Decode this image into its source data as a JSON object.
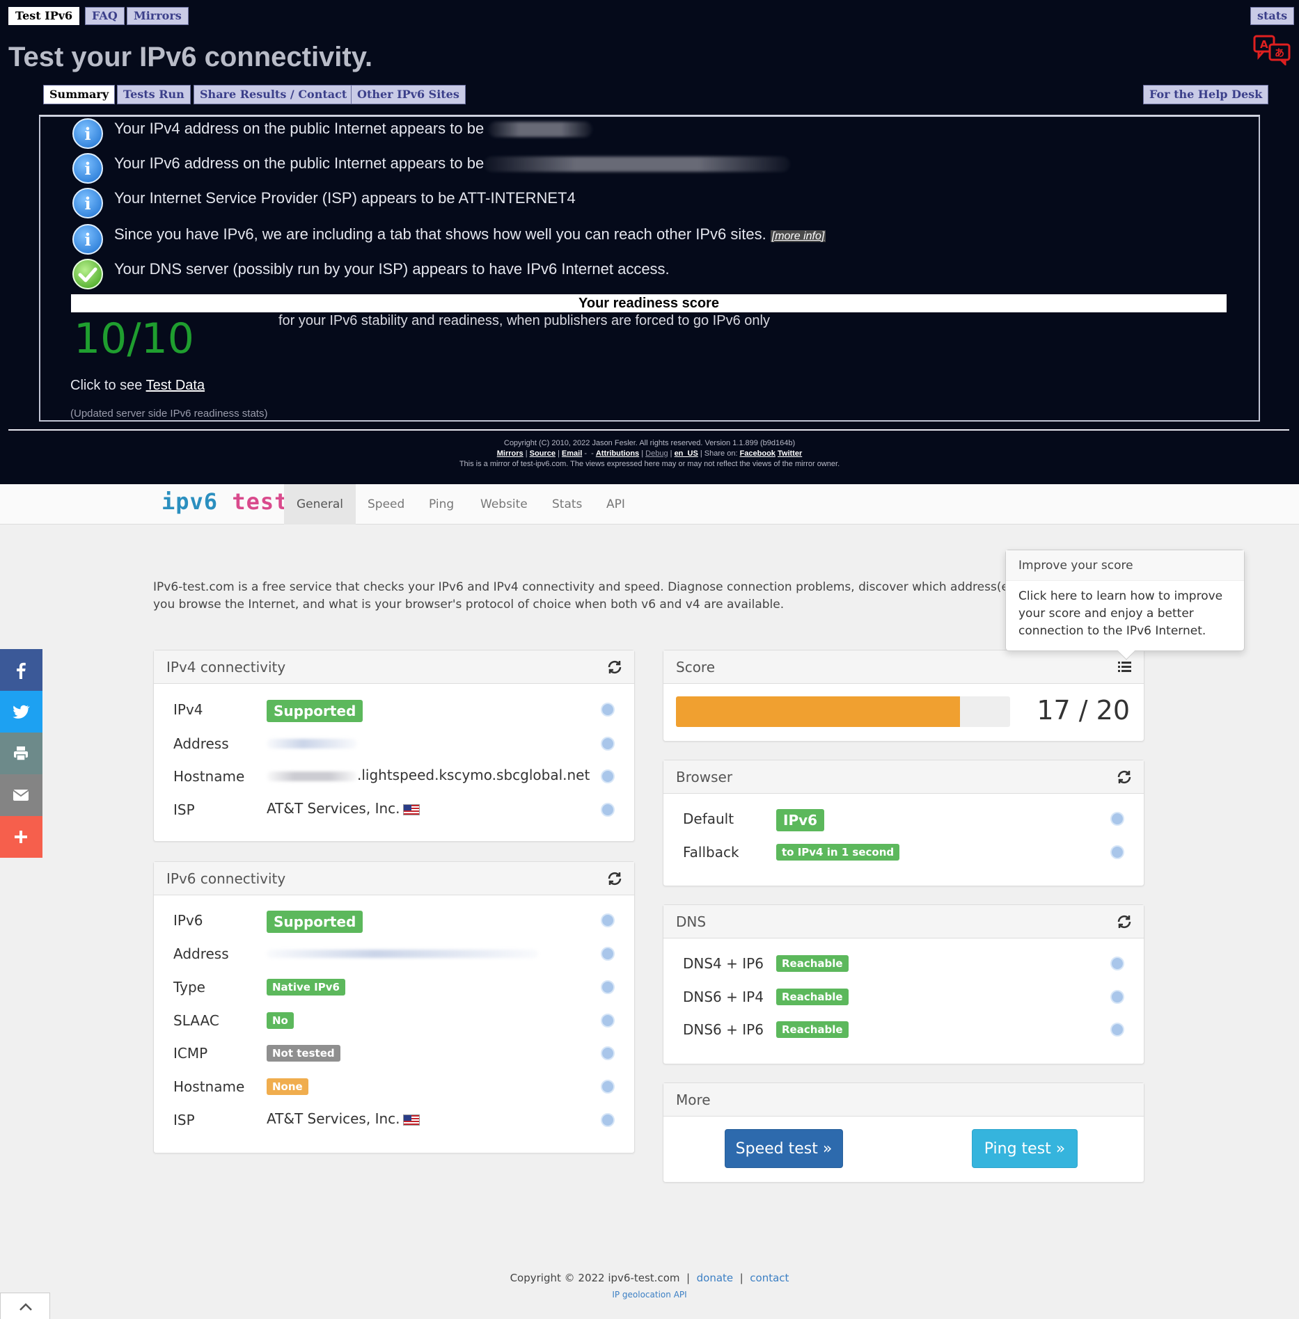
{
  "top": {
    "tabs": [
      "Test IPv6",
      "FAQ",
      "Mirrors"
    ],
    "stats_tab": "stats",
    "title": "Test your IPv6 connectivity.",
    "panel_tabs": [
      "Summary",
      "Tests Run",
      "Share Results / Contact",
      "Other IPv6 Sites"
    ],
    "helpdesk_tab": "For the Help Desk",
    "messages": [
      "Your IPv4 address on the public Internet appears to be",
      "Your IPv6 address on the public Internet appears to be",
      "Your Internet Service Provider (ISP) appears to be ATT-INTERNET4",
      "Since you have IPv6, we are including a tab that shows how well you can reach other IPv6 sites.",
      "Your DNS server (possibly run by your ISP) appears to have IPv6 Internet access."
    ],
    "more_info": "[more info]",
    "readiness_title": "Your readiness score",
    "score": "10/10",
    "score_desc": "for your IPv6 stability and readiness, when publishers are forced to go IPv6 only",
    "click_prefix": "Click to see",
    "test_data_link": "Test Data",
    "updated": "(Updated server side IPv6 readiness stats)",
    "footer_line1": "Copyright (C) 2010, 2022 Jason Fesler. All rights reserved. Version 1.1.899 (b9d164b)",
    "footer_links": [
      "Mirrors",
      "Source",
      "Email",
      "Attributions",
      "Debug",
      "en_US",
      "Facebook",
      "Twitter"
    ],
    "share_on": "Share on:",
    "footer_line3": "This is a mirror of test-ipv6.com. The views expressed here may or may not reflect the views of the mirror owner."
  },
  "nav": {
    "logo_part1": "ipv6",
    "logo_part2": "test",
    "items": [
      "General",
      "Speed",
      "Ping",
      "Website",
      "Stats",
      "API"
    ]
  },
  "intro": "IPv6-test.com is a free service that checks your IPv6 and IPv4 connectivity and speed. Diagnose connection problems, discover which address(es) you browse the Internet, and what is your browser's protocol of choice when both v6 and v4 are available.",
  "ipv4": {
    "title": "IPv4 connectivity",
    "rows": [
      {
        "label": "IPv4",
        "badge": "Supported"
      },
      {
        "label": "Address"
      },
      {
        "label": "Hostname",
        "value": ".lightspeed.kscymo.sbcglobal.net"
      },
      {
        "label": "ISP",
        "value": "AT&T Services, Inc."
      }
    ]
  },
  "ipv6": {
    "title": "IPv6 connectivity",
    "rows": [
      {
        "label": "IPv6",
        "badge": "Supported"
      },
      {
        "label": "Address"
      },
      {
        "label": "Type",
        "badge": "Native IPv6"
      },
      {
        "label": "SLAAC",
        "badge": "No"
      },
      {
        "label": "ICMP",
        "badge": "Not tested"
      },
      {
        "label": "Hostname",
        "badge": "None"
      },
      {
        "label": "ISP",
        "value": "AT&T Services, Inc."
      }
    ]
  },
  "score_card": {
    "title": "Score",
    "value": "17 / 20",
    "fraction": 0.85,
    "bar_color": "#f0a030"
  },
  "browser": {
    "title": "Browser",
    "rows": [
      {
        "label": "Default",
        "badge": "IPv6"
      },
      {
        "label": "Fallback",
        "badge": "to IPv4 in 1 second"
      }
    ]
  },
  "dns": {
    "title": "DNS",
    "rows": [
      {
        "label": "DNS4 + IP6",
        "badge": "Reachable"
      },
      {
        "label": "DNS6 + IP4",
        "badge": "Reachable"
      },
      {
        "label": "DNS6 + IP6",
        "badge": "Reachable"
      }
    ]
  },
  "more": {
    "title": "More",
    "speed_btn": "Speed test »",
    "ping_btn": "Ping test »"
  },
  "popover": {
    "title": "Improve your score",
    "body": "Click here to learn how to improve your score and enjoy a better connection to the IPv6 Internet."
  },
  "social": [
    "facebook-icon",
    "twitter-icon",
    "print-icon",
    "email-icon",
    "plus-icon"
  ],
  "colors": {
    "facebook": "#3b5998",
    "twitter": "#1da1f2",
    "print": "#6d8a8a",
    "email": "#848484",
    "plus": "#f65f4c",
    "green_badge": "#5cb85c",
    "orange_badge": "#f0ad4e",
    "grey_badge": "#8f8f8f"
  },
  "footer": {
    "copyright": "Copyright © 2022 ipv6-test.com",
    "donate": "donate",
    "contact": "contact",
    "geo": "IP geolocation API"
  }
}
